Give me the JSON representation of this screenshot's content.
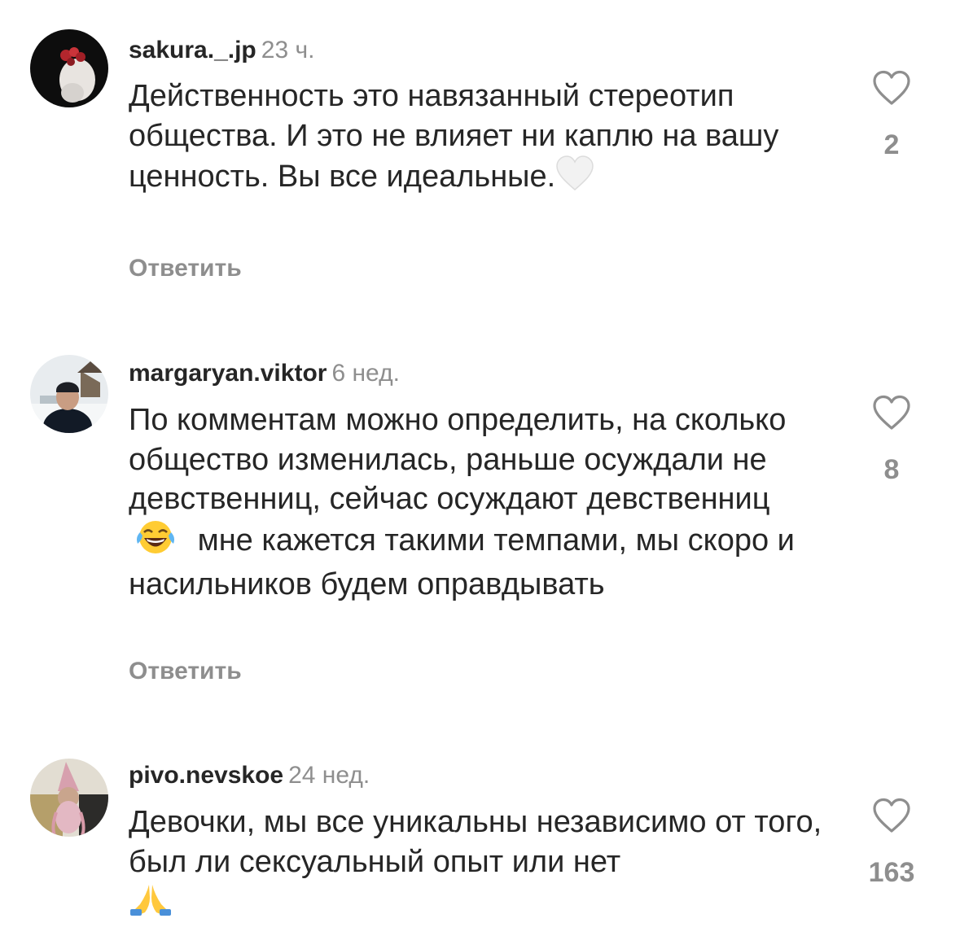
{
  "comments": [
    {
      "username": "sakura._.jp",
      "time": "23 ч.",
      "text": "Действенность это навязанный стереотип общества. И это не влияет ни каплю на вашу ценность. Вы все идеальные.",
      "emoji": "white-heart",
      "likes": "2",
      "reply_label": "Ответить"
    },
    {
      "username": "margaryan.viktor",
      "time": "6 нед.",
      "text_before_emoji": "По комментам можно определить, на сколько общество изменилась, раньше осуждали не девственниц, сейчас осуждают девственниц",
      "emoji": "face-with-tears-of-joy",
      "text_after_emoji": "мне кажется такими темпами, мы скоро и насильников будем оправдывать",
      "likes": "8",
      "reply_label": "Ответить"
    },
    {
      "username": "pivo.nevskoe",
      "time": "24 нед.",
      "text": "Девочки, мы все уникальны независимо от того, был ли сексуальный опыт или нет",
      "emoji": "folded-hands",
      "likes": "163"
    }
  ],
  "colors": {
    "text": "#262626",
    "secondary": "#8e8e8e",
    "background": "#ffffff"
  }
}
